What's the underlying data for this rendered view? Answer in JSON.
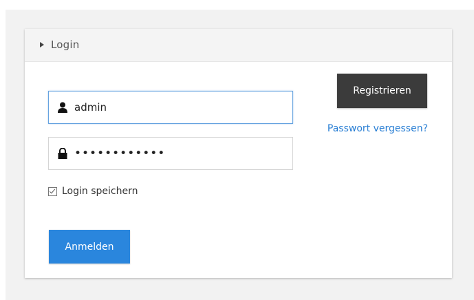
{
  "panel": {
    "title": "Login"
  },
  "form": {
    "username_value": "admin",
    "password_value": "••••••••••••",
    "remember_label": "Login speichern",
    "remember_checked": true,
    "submit_label": "Anmelden"
  },
  "side": {
    "register_label": "Registrieren",
    "forgot_label": "Passwort vergessen?"
  },
  "icons": {
    "username": "user-icon",
    "password": "lock-icon",
    "header": "caret-right-icon"
  },
  "colors": {
    "primary": "#2a86dd",
    "dark_button": "#3b3b3b",
    "link": "#2a7fd4",
    "focus_border": "#66a3e0"
  }
}
